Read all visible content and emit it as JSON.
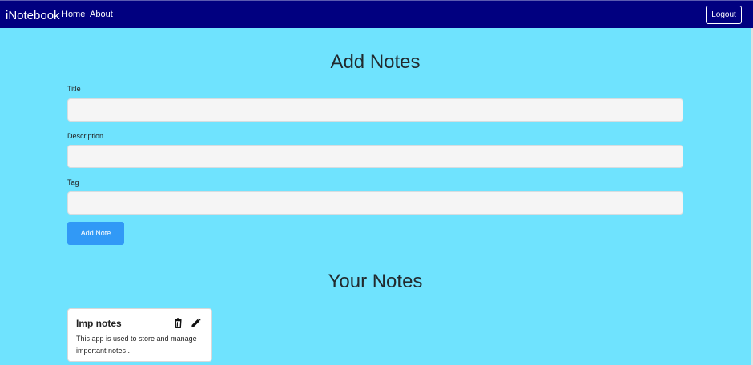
{
  "navbar": {
    "brand": "iNotebook",
    "links": [
      "Home",
      "About"
    ],
    "logout_label": "Logout"
  },
  "add_notes": {
    "heading": "Add Notes",
    "title_label": "Title",
    "title_value": "",
    "description_label": "Description",
    "description_value": "",
    "tag_label": "Tag",
    "tag_value": "",
    "add_button_label": "Add Note"
  },
  "your_notes": {
    "heading": "Your Notes",
    "notes": [
      {
        "title": "Imp notes",
        "description": "This app is used to store and manage important notes ."
      }
    ]
  },
  "icons": {
    "delete": "trash-icon",
    "edit": "pencil-icon"
  },
  "colors": {
    "navbar_bg": "#010080",
    "page_bg": "#6fe3fe",
    "button_bg": "#3199f6"
  }
}
